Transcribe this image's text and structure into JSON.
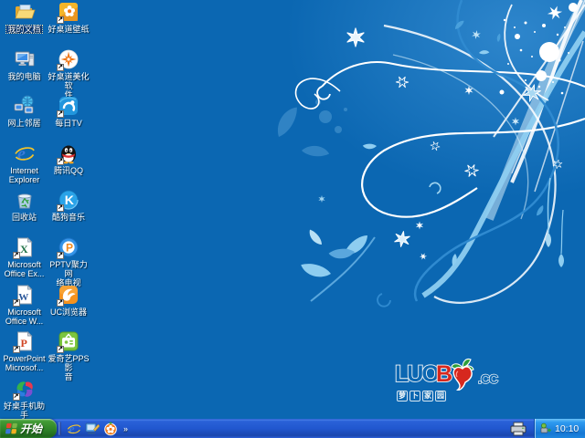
{
  "desktop": {
    "colors": {
      "wallpaper_base": "#0b67b2",
      "swirl_light": "#8ecdf0",
      "swirl_mid": "#49a0dc",
      "swirl_white": "#ffffff"
    },
    "logo": {
      "luo": "LUO",
      "b": "B",
      "suffix": ".CC",
      "stamp_text": "萝卜家园",
      "radish_color": "#d6281e",
      "leaf_color": "#2e9e3a"
    },
    "icons": [
      {
        "id": "my-documents",
        "icon": "folder-open-icon",
        "label_lines": [
          "我的文档"
        ],
        "shortcut": false,
        "selected": true
      },
      {
        "id": "haozhuodao-wallpaper",
        "icon": "wallpaper-icon",
        "label_lines": [
          "好桌道壁纸"
        ],
        "shortcut": true,
        "selected": false
      },
      {
        "id": "my-computer",
        "icon": "computer-icon",
        "label_lines": [
          "我的电脑"
        ],
        "shortcut": false,
        "selected": false
      },
      {
        "id": "haozhuodao-beautify",
        "icon": "beautify-icon",
        "label_lines": [
          "好桌道美化软",
          "件"
        ],
        "shortcut": true,
        "selected": false
      },
      {
        "id": "network-places",
        "icon": "network-icon",
        "label_lines": [
          "网上邻居"
        ],
        "shortcut": false,
        "selected": false
      },
      {
        "id": "meiri-tv",
        "icon": "tv-icon",
        "label_lines": [
          "每日TV"
        ],
        "shortcut": true,
        "selected": false
      },
      {
        "id": "internet-explorer",
        "icon": "ie-icon",
        "label_lines": [
          "Internet",
          "Explorer"
        ],
        "shortcut": false,
        "selected": false
      },
      {
        "id": "tencent-qq",
        "icon": "qq-icon",
        "label_lines": [
          "腾讯QQ"
        ],
        "shortcut": true,
        "selected": false
      },
      {
        "id": "recycle-bin",
        "icon": "recycle-icon",
        "label_lines": [
          "回收站"
        ],
        "shortcut": false,
        "selected": false
      },
      {
        "id": "kugou-music",
        "icon": "kugou-icon",
        "label_lines": [
          "酷狗音乐"
        ],
        "shortcut": true,
        "selected": false
      },
      {
        "id": "ms-office-excel",
        "icon": "excel-icon",
        "label_lines": [
          "Microsoft",
          "Office Ex..."
        ],
        "shortcut": true,
        "selected": false
      },
      {
        "id": "pptv",
        "icon": "pptv-icon",
        "label_lines": [
          "PPTV聚力 网",
          "络电视"
        ],
        "shortcut": true,
        "selected": false
      },
      {
        "id": "ms-office-word",
        "icon": "word-icon",
        "label_lines": [
          "Microsoft",
          "Office W..."
        ],
        "shortcut": true,
        "selected": false
      },
      {
        "id": "uc-browser",
        "icon": "uc-icon",
        "label_lines": [
          "UC浏览器"
        ],
        "shortcut": true,
        "selected": false
      },
      {
        "id": "ms-powerpoint",
        "icon": "powerpoint-icon",
        "label_lines": [
          "PowerPoint",
          "Microsof..."
        ],
        "shortcut": true,
        "selected": false
      },
      {
        "id": "iqiyi-pps",
        "icon": "pps-icon",
        "label_lines": [
          "爱奇艺PPS 影",
          "音"
        ],
        "shortcut": true,
        "selected": false
      },
      {
        "id": "haozhuo-phone-assistant",
        "icon": "phone-assistant-icon",
        "label_lines": [
          "好桌手机助手"
        ],
        "shortcut": true,
        "selected": false
      }
    ]
  },
  "taskbar": {
    "start_label": "开始",
    "start_color": "#2f8428",
    "quick_launch": [
      {
        "name": "ie-quicklaunch",
        "icon": "ie-icon"
      },
      {
        "name": "show-desktop",
        "icon": "show-desktop-icon"
      },
      {
        "name": "haozhuodao-launcher",
        "icon": "flower-icon"
      }
    ],
    "overflow_label": "»",
    "status_icons": [
      "printer-icon"
    ],
    "tray": {
      "icons": [
        "safely-remove-hardware-icon"
      ],
      "clock": "10:10"
    }
  }
}
